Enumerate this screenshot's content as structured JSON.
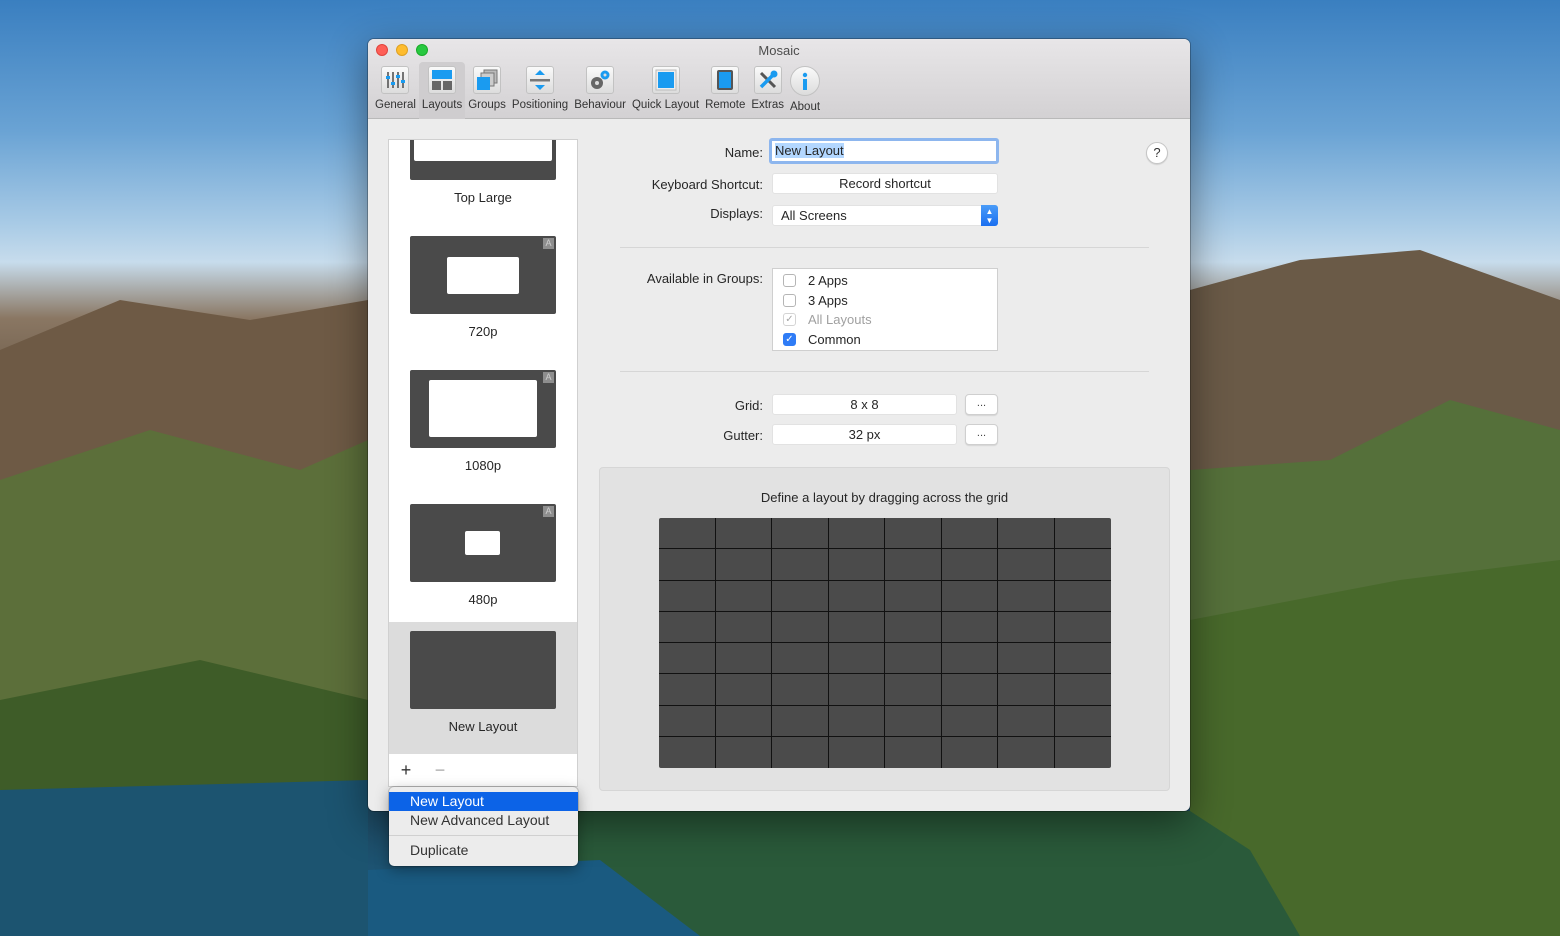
{
  "window": {
    "title": "Mosaic"
  },
  "toolbar": {
    "items": [
      {
        "label": "General",
        "icon": "sliders-icon",
        "active": false
      },
      {
        "label": "Layouts",
        "icon": "layouts-icon",
        "active": true
      },
      {
        "label": "Groups",
        "icon": "groups-icon",
        "active": false
      },
      {
        "label": "Positioning",
        "icon": "positioning-icon",
        "active": false
      },
      {
        "label": "Behaviour",
        "icon": "gears-icon",
        "active": false
      },
      {
        "label": "Quick Layout",
        "icon": "quick-layout-grid-icon",
        "active": false
      },
      {
        "label": "Remote",
        "icon": "tablet-icon",
        "active": false
      },
      {
        "label": "Extras",
        "icon": "tools-icon",
        "active": false
      },
      {
        "label": "About",
        "icon": "info-icon",
        "active": false
      }
    ]
  },
  "sidebar": {
    "layouts": [
      {
        "label": "Top Large",
        "auto_badge": false,
        "selected": false
      },
      {
        "label": "720p",
        "auto_badge": true,
        "badge": "A",
        "selected": false
      },
      {
        "label": "1080p",
        "auto_badge": true,
        "badge": "A",
        "selected": false
      },
      {
        "label": "480p",
        "auto_badge": true,
        "badge": "A",
        "selected": false
      },
      {
        "label": "New Layout",
        "auto_badge": false,
        "selected": true
      }
    ],
    "add_label": "+",
    "remove_label": "−"
  },
  "form": {
    "name_label": "Name:",
    "name_value": "New Layout",
    "shortcut_label": "Keyboard Shortcut:",
    "shortcut_value": "Record shortcut",
    "displays_label": "Displays:",
    "displays_value": "All Screens",
    "groups_label": "Available in Groups:",
    "groups": [
      {
        "label": "2 Apps",
        "checked": false,
        "disabled": false
      },
      {
        "label": "3 Apps",
        "checked": false,
        "disabled": false
      },
      {
        "label": "All Layouts",
        "checked": true,
        "disabled": true
      },
      {
        "label": "Common",
        "checked": true,
        "disabled": false
      }
    ],
    "grid_label": "Grid:",
    "grid_value": "8 x 8",
    "gutter_label": "Gutter:",
    "gutter_value": "32 px",
    "more_label": "...",
    "help_label": "?"
  },
  "grid_panel": {
    "caption": "Define a layout by dragging across the grid",
    "columns": 8,
    "rows": 8
  },
  "add_menu": {
    "items": [
      {
        "label": "New Layout",
        "highlighted": true
      },
      {
        "label": "New Advanced Layout",
        "highlighted": false
      },
      {
        "label": "Duplicate",
        "highlighted": false
      }
    ]
  },
  "colors": {
    "accent": "#0c63e7",
    "checkbox_blue": "#2f7cf6",
    "icon_blue": "#1a9bf0"
  }
}
